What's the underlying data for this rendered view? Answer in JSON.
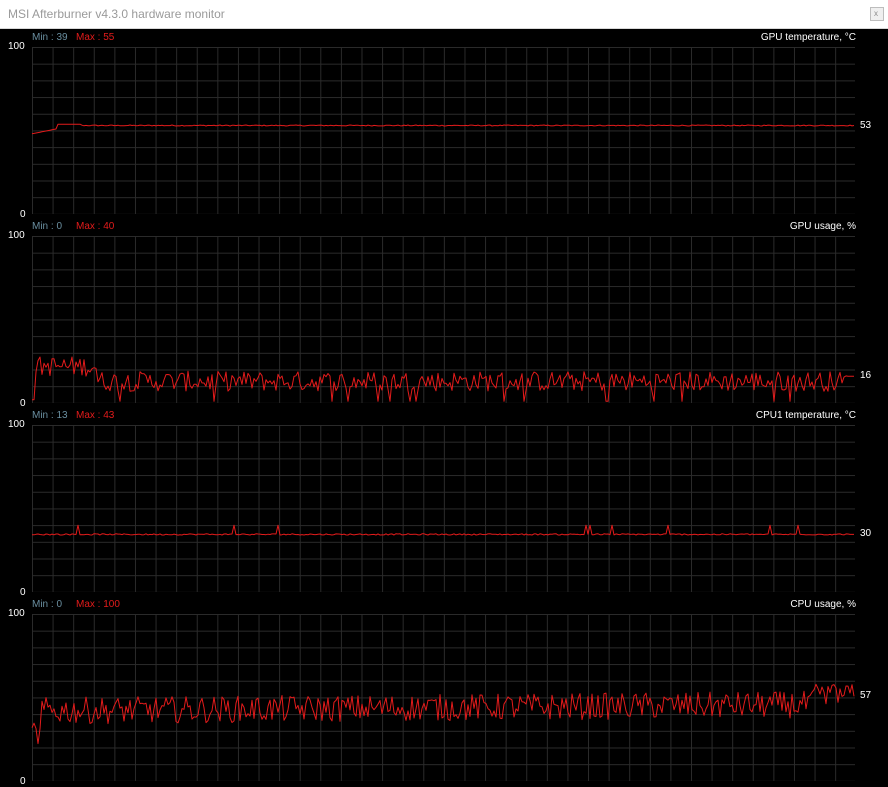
{
  "window": {
    "title": "MSI Afterburner v4.3.0 hardware monitor",
    "close_label": "x"
  },
  "colors": {
    "line": "#e31b1b",
    "grid": "#2b2b2b",
    "min_label": "#6a8fa0",
    "max_label": "#e31b1b"
  },
  "graphs": [
    {
      "name": "GPU temperature, °C",
      "min_label": "Min : 39",
      "max_label": "Max : 55",
      "y_max": "100",
      "y_min": "0",
      "current": "53",
      "current_value": 53,
      "range": [
        0,
        100
      ]
    },
    {
      "name": "GPU usage, %",
      "min_label": "Min : 0",
      "max_label": "Max : 40",
      "y_max": "100",
      "y_min": "0",
      "current": "16",
      "current_value": 16,
      "range": [
        0,
        100
      ]
    },
    {
      "name": "CPU1 temperature, °C",
      "min_label": "Min : 13",
      "max_label": "Max : 43",
      "y_max": "100",
      "y_min": "0",
      "current": "30",
      "current_value": 30,
      "range": [
        0,
        100
      ]
    },
    {
      "name": "CPU usage, %",
      "min_label": "Min : 0",
      "max_label": "Max : 100",
      "y_max": "100",
      "y_min": "0",
      "current": "57",
      "current_value": 57,
      "range": [
        0,
        100
      ]
    }
  ]
}
